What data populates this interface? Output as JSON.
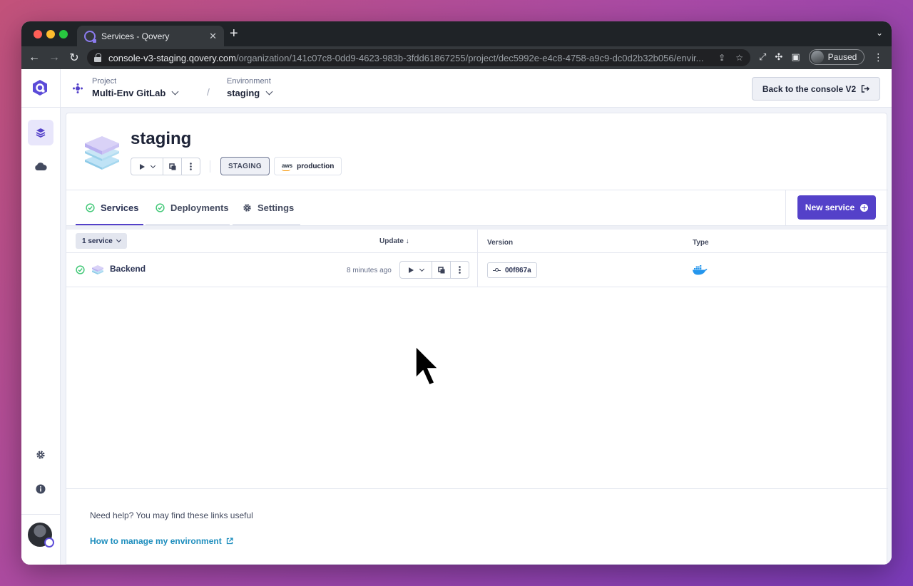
{
  "browser": {
    "tab_title": "Services - Qovery",
    "url_host": "console-v3-staging.qovery.com",
    "url_path": "/organization/141c07c8-0dd9-4623-983b-3fdd61867255/project/dec5992e-e4c8-4758-a9c9-dc0d2b32b056/envir...",
    "profile_status": "Paused"
  },
  "header": {
    "project_label": "Project",
    "project_value": "Multi-Env GitLab",
    "environment_label": "Environment",
    "environment_value": "staging",
    "back_button": "Back to the console V2"
  },
  "environment": {
    "name": "staging",
    "mode_badge": "STAGING",
    "cluster_badge": "production"
  },
  "tabs": [
    {
      "label": "Services"
    },
    {
      "label": "Deployments"
    },
    {
      "label": "Settings"
    }
  ],
  "new_service_button": "New service",
  "table": {
    "count": "1 service",
    "col_update": "Update ↓",
    "col_version": "Version",
    "col_type": "Type",
    "rows": [
      {
        "name": "Backend",
        "updated": "8 minutes ago",
        "version": "00f867a"
      }
    ]
  },
  "help": {
    "text": "Need help? You may find these links useful",
    "link": "How to manage my environment"
  },
  "colors": {
    "accent": "#5441c9",
    "success": "#44c979",
    "link": "#1c8dbd"
  }
}
